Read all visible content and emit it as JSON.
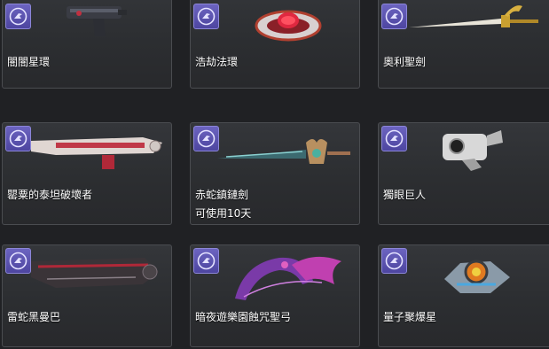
{
  "items": [
    {
      "name": "闇闇星環",
      "icon": "blaster-pistol-icon"
    },
    {
      "name": "浩劫法環",
      "icon": "ring-launcher-icon"
    },
    {
      "name": "奧利聖劍",
      "icon": "golden-sword-icon"
    },
    {
      "name": "罌粟的泰坦破壞者",
      "icon": "heavy-rifle-icon"
    },
    {
      "name": "赤蛇鎮鏈劍",
      "sub": "可使用10天",
      "icon": "chain-sword-icon"
    },
    {
      "name": "獨眼巨人",
      "icon": "cyclops-gauntlet-icon"
    },
    {
      "name": "雷蛇黑曼巴",
      "icon": "snake-rifle-icon"
    },
    {
      "name": "暗夜遊樂園蝕咒聖弓",
      "icon": "bat-bow-icon"
    },
    {
      "name": "量子聚爆星",
      "icon": "quantum-star-icon"
    }
  ],
  "colors": {
    "badge": "#5a52b0",
    "text": "#ffffff",
    "card_border": "#4a4c50"
  }
}
